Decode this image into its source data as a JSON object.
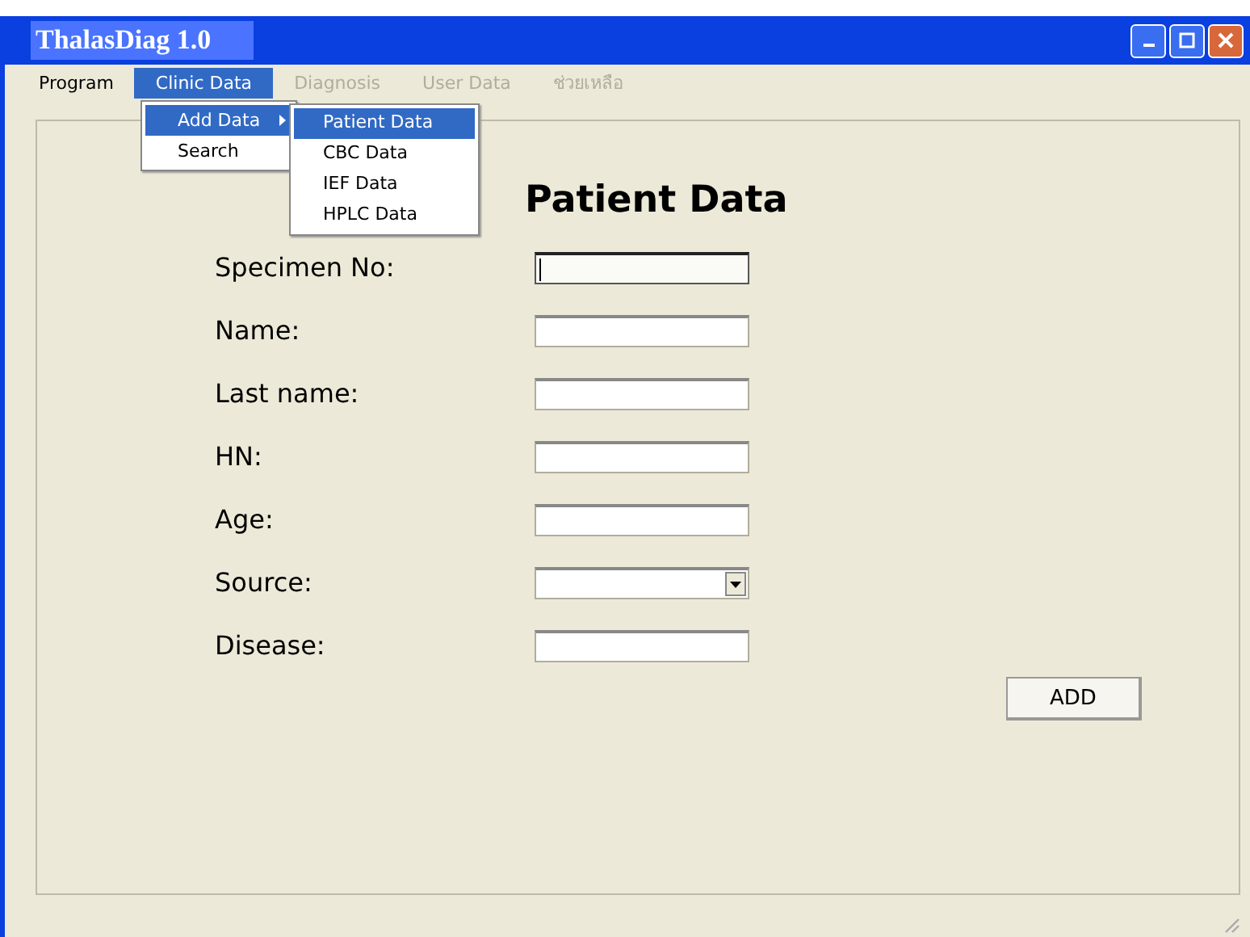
{
  "window": {
    "title": "ThalasDiag 1.0"
  },
  "menu_bar": [
    {
      "label": "Program",
      "disabled": false,
      "selected": false
    },
    {
      "label": "Clinic Data",
      "disabled": false,
      "selected": true
    },
    {
      "label": "Diagnosis",
      "disabled": true,
      "selected": false
    },
    {
      "label": "User Data",
      "disabled": true,
      "selected": false
    },
    {
      "label": "ช่วยเหลือ",
      "disabled": true,
      "selected": false
    }
  ],
  "dropdown": {
    "items": [
      {
        "label": "Add Data",
        "selected": true,
        "submenu": true
      },
      {
        "label": "Search",
        "selected": false,
        "submenu": false
      }
    ]
  },
  "submenu": {
    "items": [
      {
        "label": "Patient Data",
        "selected": true
      },
      {
        "label": "CBC Data",
        "selected": false
      },
      {
        "label": "IEF Data",
        "selected": false
      },
      {
        "label": "HPLC Data",
        "selected": false
      }
    ]
  },
  "form": {
    "title": "Patient Data",
    "fields": [
      {
        "label": "Specimen No:",
        "kind": "text",
        "focused": true
      },
      {
        "label": "Name:",
        "kind": "text",
        "focused": false
      },
      {
        "label": "Last name:",
        "kind": "text",
        "focused": false
      },
      {
        "label": "HN:",
        "kind": "text",
        "focused": false
      },
      {
        "label": "Age:",
        "kind": "text",
        "focused": false
      },
      {
        "label": "Source:",
        "kind": "select",
        "focused": false
      },
      {
        "label": "Disease:",
        "kind": "text",
        "focused": false
      }
    ],
    "button": "ADD"
  }
}
